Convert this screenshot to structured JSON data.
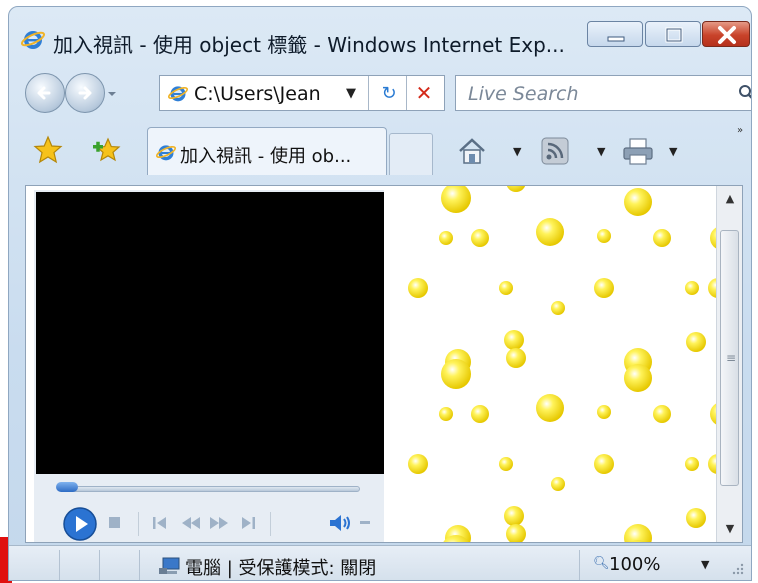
{
  "window": {
    "title": "加入視訊 - 使用 object 標籤 - Windows Internet Exp..."
  },
  "address_bar": {
    "url": "C:\\Users\\Jean"
  },
  "search": {
    "placeholder": "Live Search"
  },
  "tab": {
    "label": "加入視訊 - 使用 ob..."
  },
  "status_bar": {
    "zone_text": "電腦 | 受保護模式: 關閉",
    "zoom": "100%"
  },
  "colors": {
    "window_frame": "#c9dcef",
    "close_button": "#c9432a",
    "dot_yellow": "#ffe600",
    "video_bg": "#000000",
    "red_marker": "#e0100f"
  },
  "icons": [
    "ie-logo-icon",
    "minimize-icon",
    "maximize-icon",
    "close-icon",
    "back-arrow-icon",
    "forward-arrow-icon",
    "refresh-icon",
    "stop-icon",
    "search-icon",
    "favorites-star-icon",
    "add-favorites-icon",
    "home-icon",
    "rss-feed-icon",
    "print-icon",
    "computer-icon",
    "zoom-icon",
    "play-icon",
    "stop-media-icon",
    "previous-icon",
    "rewind-icon",
    "fast-forward-icon",
    "next-icon",
    "volume-icon"
  ]
}
